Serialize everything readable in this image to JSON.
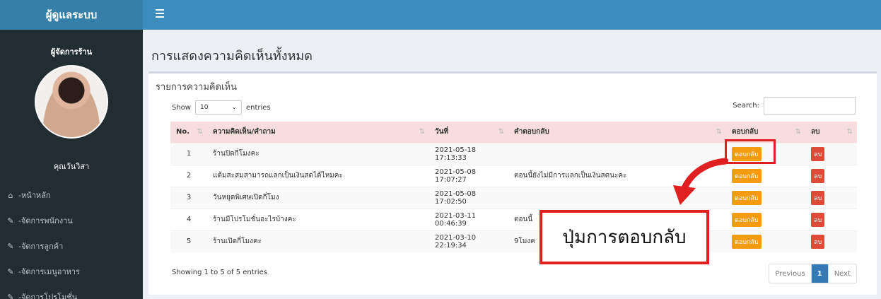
{
  "header": {
    "logo": "ผู้ดูแลระบบ"
  },
  "sidebar": {
    "role": "ผู้จัดการร้าน",
    "user_name": "คุณวันวิสา",
    "items": [
      {
        "label": "-หน้าหลัก",
        "icon": "home-icon"
      },
      {
        "label": "-จัดการพนักงาน",
        "icon": "edit-icon"
      },
      {
        "label": "-จัดการลูกค้า",
        "icon": "edit-icon"
      },
      {
        "label": "-จัดการเมนูอาหาร",
        "icon": "edit-icon"
      },
      {
        "label": "-จัดการโปรโมชั่น",
        "icon": "edit-icon"
      }
    ]
  },
  "page": {
    "title": "การแสดงความคิดเห็นทั้งหมด"
  },
  "box": {
    "title": "รายการความคิดเห็น"
  },
  "length": {
    "show": "Show",
    "value": "10",
    "entries": "entries"
  },
  "search": {
    "label": "Search:",
    "value": ""
  },
  "table": {
    "headers": [
      "No.",
      "ความคิดเห็น/คำถาม",
      "วันที่",
      "คำตอบกลับ",
      "ตอบกลับ",
      "ลบ"
    ],
    "rows": [
      {
        "no": "1",
        "comment": "ร้านปิดกี่โมงคะ",
        "date": "2021-05-18 17:13:33",
        "answer": "",
        "reply": "ตอบกลับ",
        "delete": "ลบ"
      },
      {
        "no": "2",
        "comment": "แต้มสะสมสามารถแลกเป็นเงินสดได้ไหมคะ",
        "date": "2021-05-08 17:07:27",
        "answer": "ตอนนี้ยังไม่มีการแลกเป็นเงินสดนะคะ",
        "reply": "ตอบกลับ",
        "delete": "ลบ"
      },
      {
        "no": "3",
        "comment": "วันหยุดพิเศษเปิดกี่โมง",
        "date": "2021-05-08 17:02:50",
        "answer": "",
        "reply": "ตอบกลับ",
        "delete": "ลบ"
      },
      {
        "no": "4",
        "comment": "ร้านมีโปรโมชั่นอะไรบ้างคะ",
        "date": "2021-03-11 00:46:39",
        "answer": "ตอนนี้",
        "reply": "ตอบกลับ",
        "delete": "ลบ"
      },
      {
        "no": "5",
        "comment": "ร้านเปิดกี่โมงคะ",
        "date": "2021-03-10 22:19:34",
        "answer": "9โมงค",
        "reply": "ตอบกลับ",
        "delete": "ลบ"
      }
    ]
  },
  "footer": {
    "info": "Showing 1 to 5 of 5 entries",
    "prev": "Previous",
    "page": "1",
    "next": "Next"
  },
  "annotation": {
    "callout": "ปุ่มการตอบกลับ",
    "color": "#e02020"
  },
  "colors": {
    "topbar": "#3c8dbc",
    "sidebar": "#222d32",
    "reply_button": "#f39c12",
    "delete_button": "#dd4b39",
    "header_row": "#f7dddd"
  }
}
